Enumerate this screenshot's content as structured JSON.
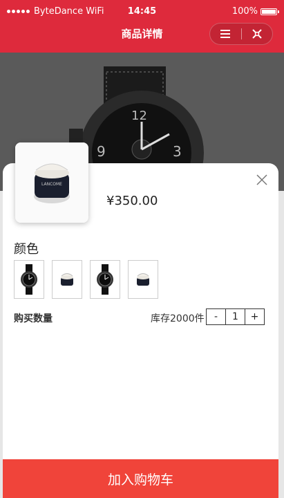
{
  "status": {
    "carrier": "ByteDance WiFi",
    "time": "14:45",
    "battery": "100%"
  },
  "nav": {
    "title": "商品详情",
    "menu_icon": "menu-icon",
    "close_icon": "close-target-icon"
  },
  "product": {
    "price": "¥350.00"
  },
  "options": {
    "color_label": "颜色",
    "swatches": [
      "watch-black",
      "cream-jar",
      "watch-black",
      "cream-jar"
    ]
  },
  "quantity": {
    "label": "购买数量",
    "stock": "库存2000件",
    "minus": "-",
    "value": "1",
    "plus": "+"
  },
  "cart": {
    "button_label": "加入购物车"
  },
  "colors": {
    "accent_red": "#de2a3c",
    "cta_red": "#f0443a"
  }
}
